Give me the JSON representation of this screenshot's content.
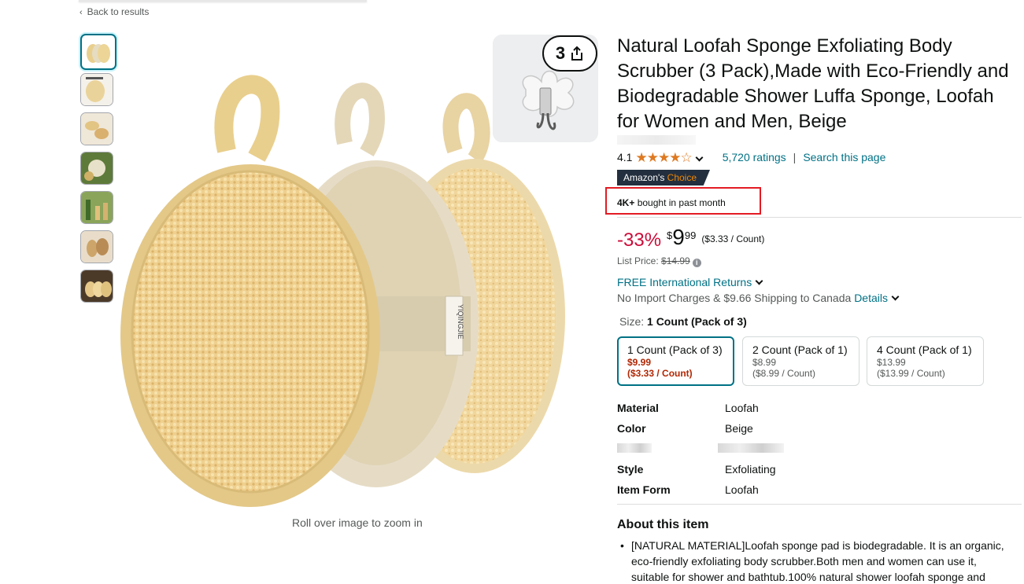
{
  "nav": {
    "back_label": "Back to results"
  },
  "gallery": {
    "thumbnail_count": 7,
    "zoom_hint": "Roll over image to zoom in",
    "tag_text": "YIQINGJIE"
  },
  "overlay": {
    "count": "3"
  },
  "product": {
    "title": "Natural Loofah Sponge Exfoliating Body Scrubber (3 Pack),Made with Eco-Friendly and Biodegradable Shower Luffa Sponge, Loofah for Women and Men, Beige",
    "rating_value": "4.1",
    "rating_stars": 4.1,
    "ratings_count": "5,720 ratings",
    "search_page": "Search this page",
    "separator": "|",
    "badge_prefix": "Amazon's ",
    "badge_highlight": "Choice",
    "bought_strong": "4K+",
    "bought_rest": " bought in past month"
  },
  "price": {
    "discount": "-33%",
    "currency": "$",
    "dollars": "9",
    "cents": "99",
    "per_unit": "($3.33 / Count)",
    "list_label": "List Price: ",
    "list_value": "$14.99"
  },
  "shipping": {
    "returns": "FREE International Returns",
    "charges": "No Import Charges & $9.66 Shipping to Canada ",
    "details": "Details"
  },
  "size": {
    "label": "Size: ",
    "selected": "1 Count (Pack of 3)",
    "options": [
      {
        "title": "1 Count (Pack of 3)",
        "price": "$9.99",
        "unit": "($3.33 / Count)"
      },
      {
        "title": "2 Count (Pack of 1)",
        "price": "$8.99",
        "unit": "($8.99 / Count)"
      },
      {
        "title": "4 Count (Pack of 1)",
        "price": "$13.99",
        "unit": "($13.99 / Count)"
      }
    ]
  },
  "specs": [
    {
      "key": "Material",
      "value": "Loofah"
    },
    {
      "key": "Color",
      "value": "Beige"
    },
    {
      "key": "Style",
      "value": "Exfoliating"
    },
    {
      "key": "Item Form",
      "value": "Loofah"
    }
  ],
  "about": {
    "heading": "About this item",
    "bullet1": "[NATURAL MATERIAL]Loofah sponge pad is biodegradable. It is an organic, eco-friendly exfoliating body scrubber.Both men and women can use it, suitable for shower and bathtub.100% natural shower loofah sponge and"
  },
  "colors": {
    "link": "#007185",
    "discount": "#cc0c39",
    "star": "#de7921",
    "badge_bg": "#232f3e",
    "highlight_box": "#e31b23",
    "selected_border": "#007185"
  },
  "icons": [
    "chevron-left-icon",
    "star-icon",
    "chevron-down-icon",
    "share-icon",
    "info-icon"
  ]
}
